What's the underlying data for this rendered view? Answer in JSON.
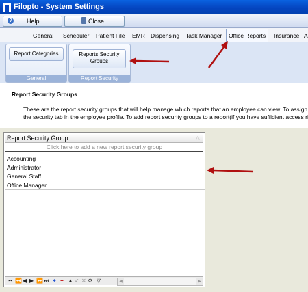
{
  "window": {
    "title": "Filopto - System Settings"
  },
  "toolbar": {
    "help_label": "Help",
    "close_label": "Close"
  },
  "tabs": [
    "General",
    "Scheduler",
    "Patient File",
    "EMR",
    "Dispensing",
    "Task Manager",
    "Office Reports",
    "Insurance",
    "A"
  ],
  "active_tab": "Office Reports",
  "ribbon": {
    "general_group": {
      "caption": "General",
      "button": "Report Categories"
    },
    "security_group": {
      "caption": "Report Security",
      "button_line1": "Reports Security",
      "button_line2": "Groups"
    }
  },
  "description": {
    "title": "Report Security Groups",
    "line1": "These are the report security groups that will help manage which reports that an employee can view.  To assign report",
    "line2": "the security tab in the employee profile.  To add report security groups to a report(if you have sufficient access rights), g"
  },
  "grid": {
    "column_header": "Report Security Group",
    "add_row_text": "Click here to add a new report security group",
    "rows": [
      "Accounting",
      "Administrator",
      "General Staff",
      "Office Manager"
    ]
  },
  "colors": {
    "annotation_arrow": "#b01010",
    "title_bar": "#0545c0",
    "ribbon_bg": "#dbe5f5",
    "workspace": "#e9e9dc"
  }
}
